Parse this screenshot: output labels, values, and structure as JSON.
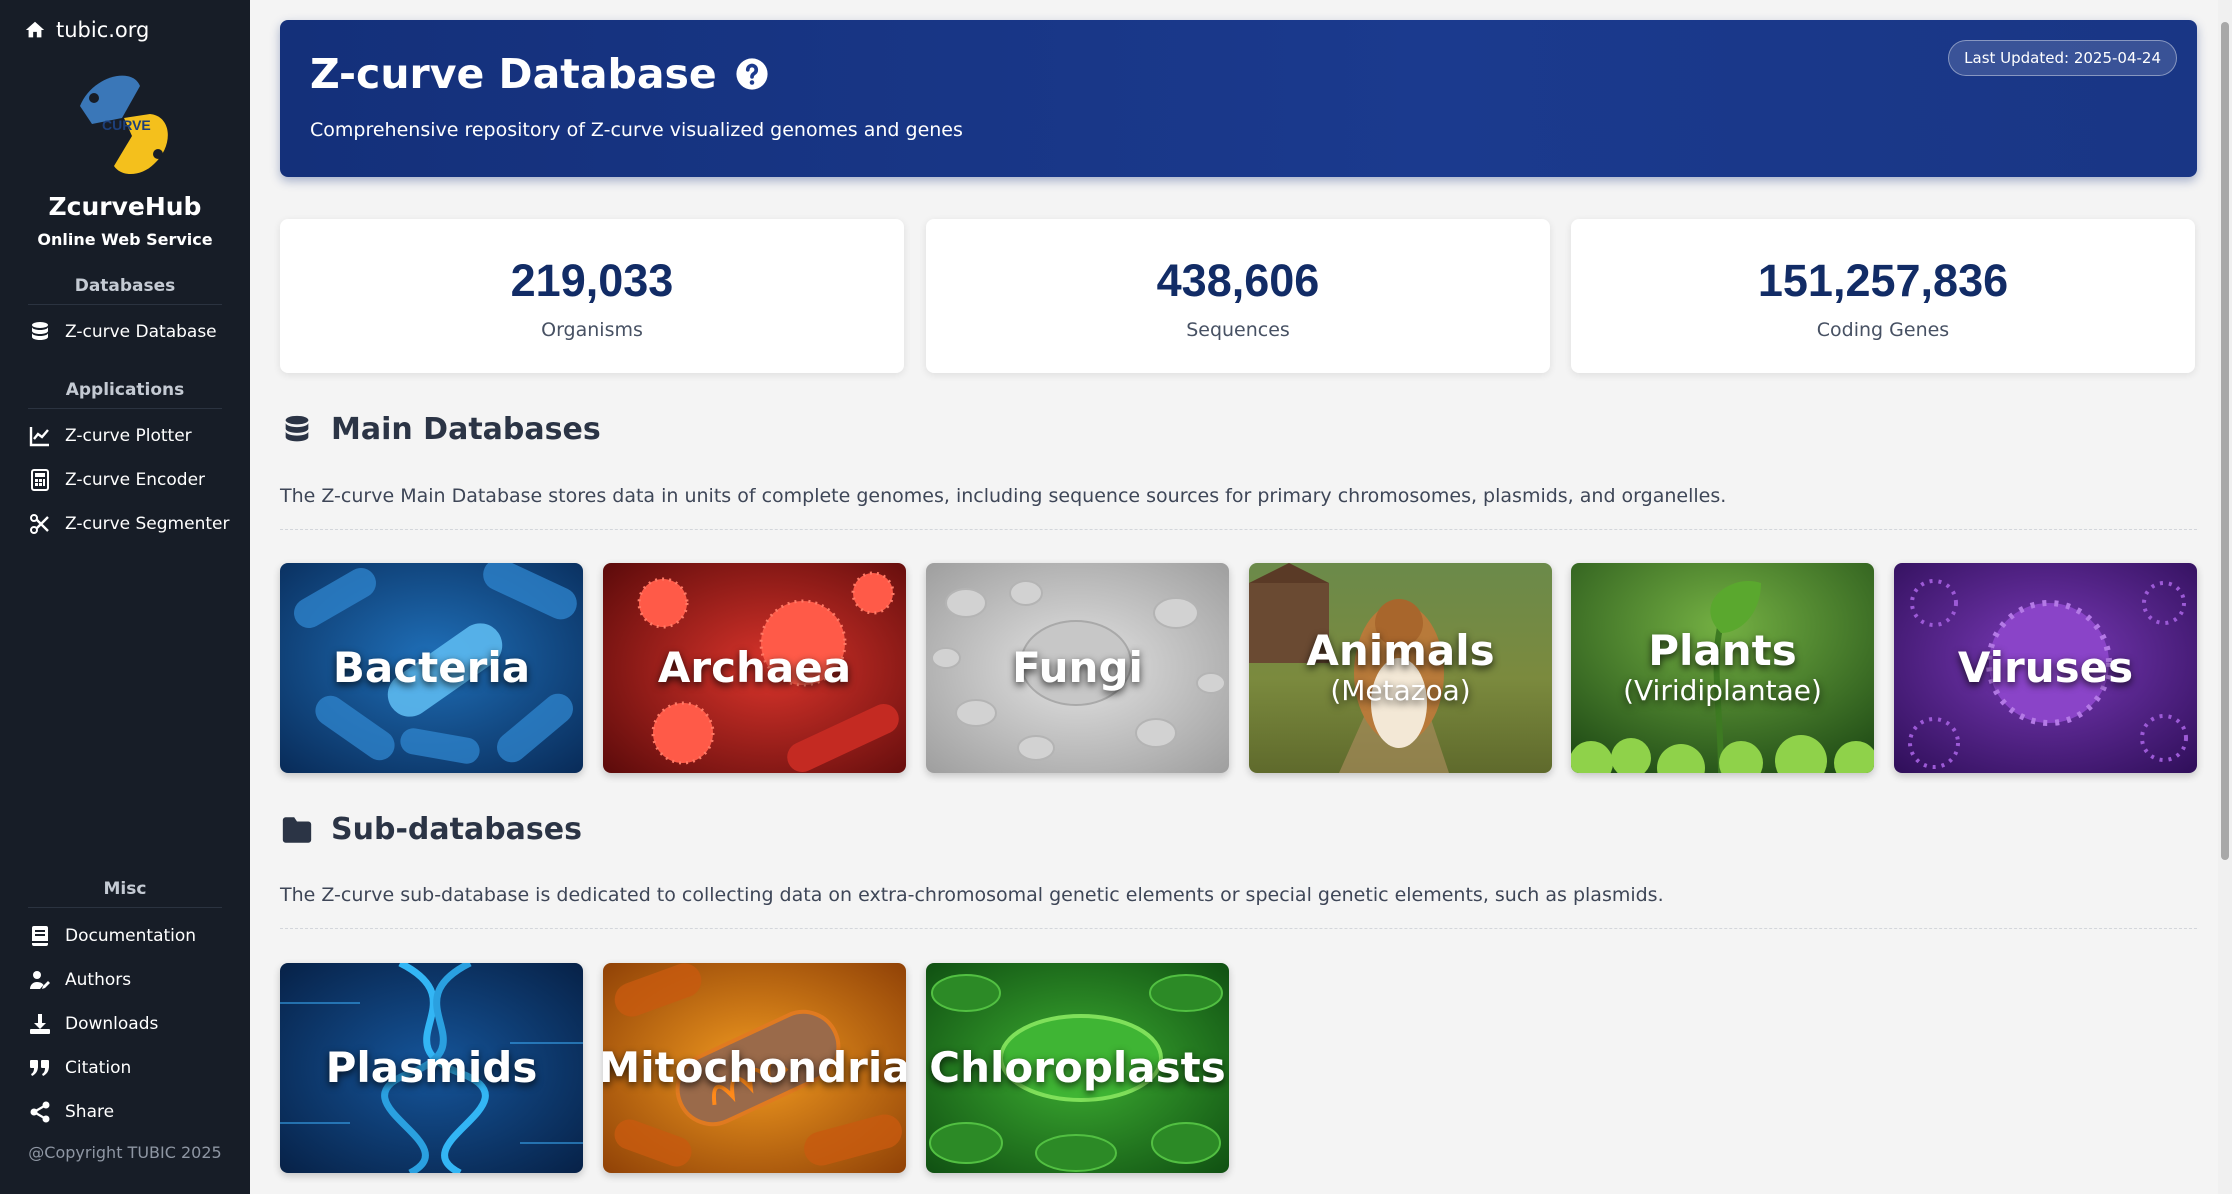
{
  "sidebar": {
    "home_link": "tubic.org",
    "brand_title": "ZcurveHub",
    "brand_subtitle": "Online Web Service",
    "logo_text": "CURVE",
    "sections": {
      "databases": "Databases",
      "applications": "Applications",
      "misc": "Misc"
    },
    "items": {
      "zcurve_database": "Z-curve Database",
      "plotter": "Z-curve Plotter",
      "encoder": "Z-curve Encoder",
      "segmenter": "Z-curve Segmenter",
      "documentation": "Documentation",
      "authors": "Authors",
      "downloads": "Downloads",
      "citation": "Citation",
      "share": "Share"
    },
    "copyright": "@Copyright TUBIC 2025"
  },
  "header": {
    "title": "Z-curve Database",
    "subtitle": "Comprehensive repository of Z-curve visualized genomes and genes",
    "last_updated": "Last Updated: 2025-04-24"
  },
  "stats": [
    {
      "value": "219,033",
      "label": "Organisms"
    },
    {
      "value": "438,606",
      "label": "Sequences"
    },
    {
      "value": "151,257,836",
      "label": "Coding Genes"
    }
  ],
  "main_databases": {
    "title": "Main Databases",
    "description": "The Z-curve Main Database stores data in units of complete genomes, including sequence sources for primary chromosomes, plasmids, and organelles.",
    "tiles": [
      {
        "name": "Bacteria",
        "sub": ""
      },
      {
        "name": "Archaea",
        "sub": ""
      },
      {
        "name": "Fungi",
        "sub": ""
      },
      {
        "name": "Animals",
        "sub": "(Metazoa)"
      },
      {
        "name": "Plants",
        "sub": "(Viridiplantae)"
      },
      {
        "name": "Viruses",
        "sub": ""
      }
    ]
  },
  "sub_databases": {
    "title": "Sub-databases",
    "description": "The Z-curve sub-database is dedicated to collecting data on extra-chromosomal genetic elements or special genetic elements, such as plasmids.",
    "tiles": [
      {
        "name": "Plasmids"
      },
      {
        "name": "Mitochondria"
      },
      {
        "name": "Chloroplasts"
      }
    ]
  },
  "colors": {
    "sidebar_bg": "#171d27",
    "hero_bg": "#1b3a8e",
    "stat_value": "#122c66",
    "page_bg": "#f4f4f4"
  }
}
